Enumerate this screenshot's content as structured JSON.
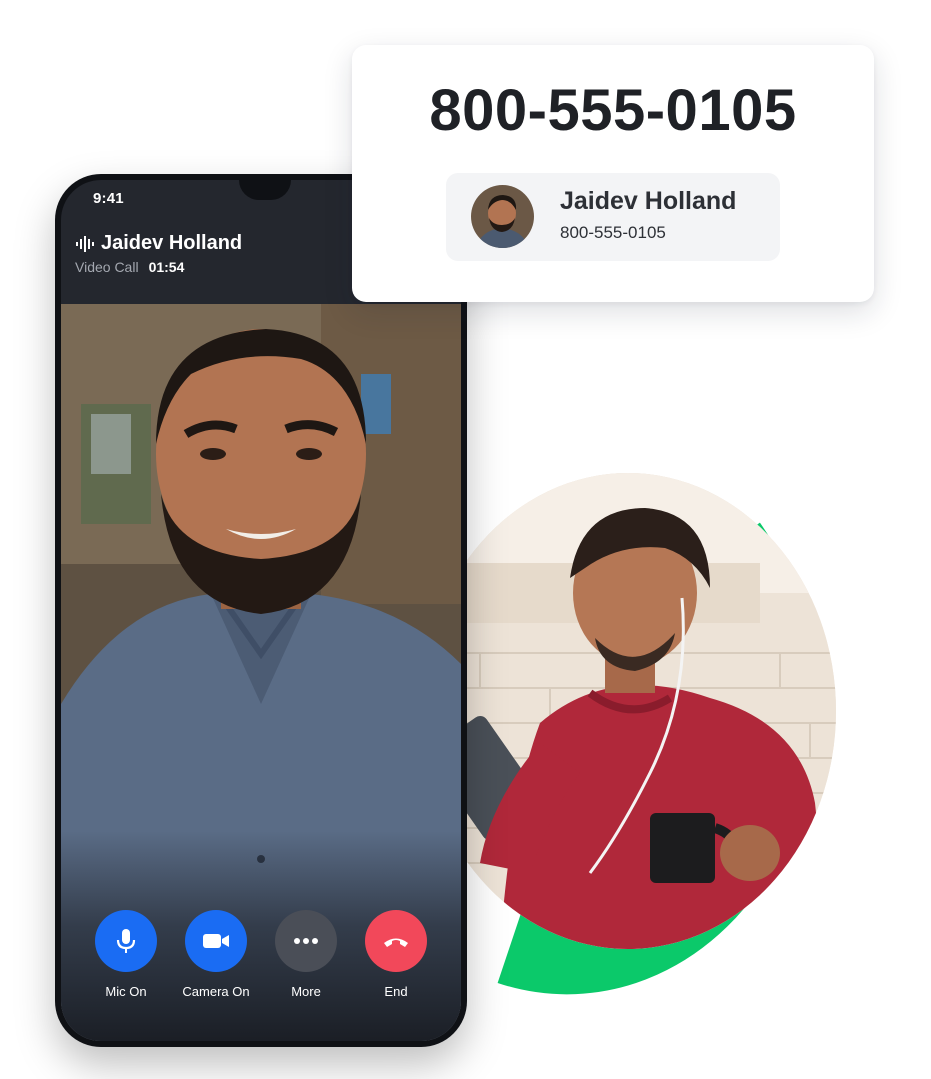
{
  "colors": {
    "accent_green": "#0bc96a",
    "button_blue": "#1a6cf3",
    "button_gray": "#4a4e57",
    "button_red": "#f2485a",
    "card_bg": "#ffffff",
    "chip_bg": "#f3f4f6"
  },
  "number_card": {
    "dialed_number": "800-555-0105",
    "contact": {
      "name": "Jaidev Holland",
      "number": "800-555-0105",
      "avatar_icon": "person-avatar"
    }
  },
  "phone": {
    "status_time": "9:41",
    "caller_name": "Jaidev Holland",
    "call_type": "Video Call",
    "call_duration": "01:54",
    "indicator_icon": "audio-wave-icon",
    "controls": [
      {
        "label": "Mic On",
        "icon": "microphone-icon",
        "color": "#1a6cf3"
      },
      {
        "label": "Camera On",
        "icon": "video-camera-icon",
        "color": "#1a6cf3"
      },
      {
        "label": "More",
        "icon": "more-dots-icon",
        "color": "#4a4e57"
      },
      {
        "label": "End",
        "icon": "hang-up-icon",
        "color": "#f2485a"
      }
    ]
  }
}
